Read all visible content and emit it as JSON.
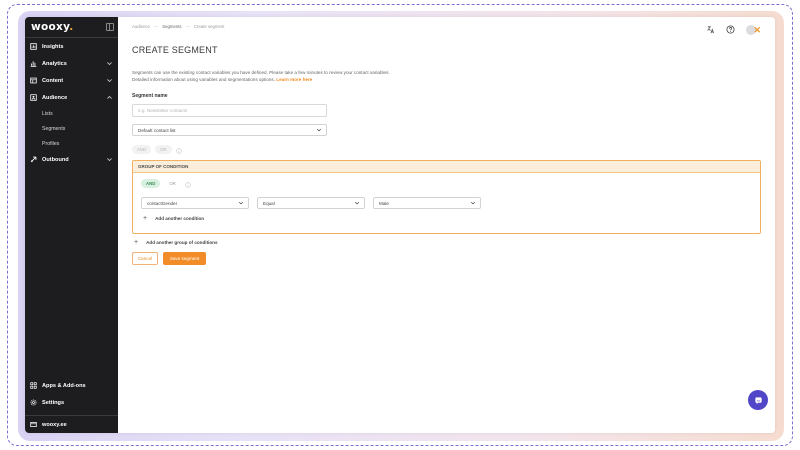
{
  "app": {
    "logo": "wooxy",
    "logo_dot": "."
  },
  "sidebar": {
    "items": [
      {
        "label": "Insights",
        "icon": "insights-icon"
      },
      {
        "label": "Analytics",
        "icon": "analytics-icon"
      },
      {
        "label": "Content",
        "icon": "content-icon"
      },
      {
        "label": "Audience",
        "icon": "audience-icon"
      },
      {
        "label": "Outbound",
        "icon": "outbound-icon"
      }
    ],
    "sub_items": [
      "Lists",
      "Segments",
      "Profiles"
    ],
    "bottom": [
      {
        "label": "Apps & Add-ons",
        "icon": "apps-icon"
      },
      {
        "label": "Settings",
        "icon": "gear-icon"
      }
    ],
    "account": "wooxy.ee"
  },
  "breadcrumb": [
    "Audience",
    "Segments",
    "Create segment"
  ],
  "page": {
    "title": "CREATE SEGMENT",
    "description_line1": "Segments can use the existing contact variables you have defined. Please take a few minutes to review your contact variables.",
    "description_line2": "Detailed information about using variables and segmentations options.",
    "learn_more": "Learn more here"
  },
  "form": {
    "segment_name_label": "Segment name",
    "segment_name_placeholder": "e.g. Newsletter contacts",
    "segment_name_value": "",
    "contact_list": "Default contact list",
    "top_toggle": {
      "and": "AND",
      "or": "OR"
    }
  },
  "group": {
    "header": "GROUP OF CONDITION",
    "toggle": {
      "and": "AND",
      "or": "OR"
    },
    "condition": {
      "field": "contactGender",
      "operator": "Equal",
      "value": "Male"
    },
    "add_condition": "Add another condition"
  },
  "add_group": "Add another group of conditions",
  "actions": {
    "cancel": "Cancel",
    "save": "Save segment"
  },
  "colors": {
    "accent": "#f28c28",
    "sidebar_bg": "#1d1d1f",
    "chat_fab": "#5146c8",
    "and_active": "#d8f0df"
  }
}
